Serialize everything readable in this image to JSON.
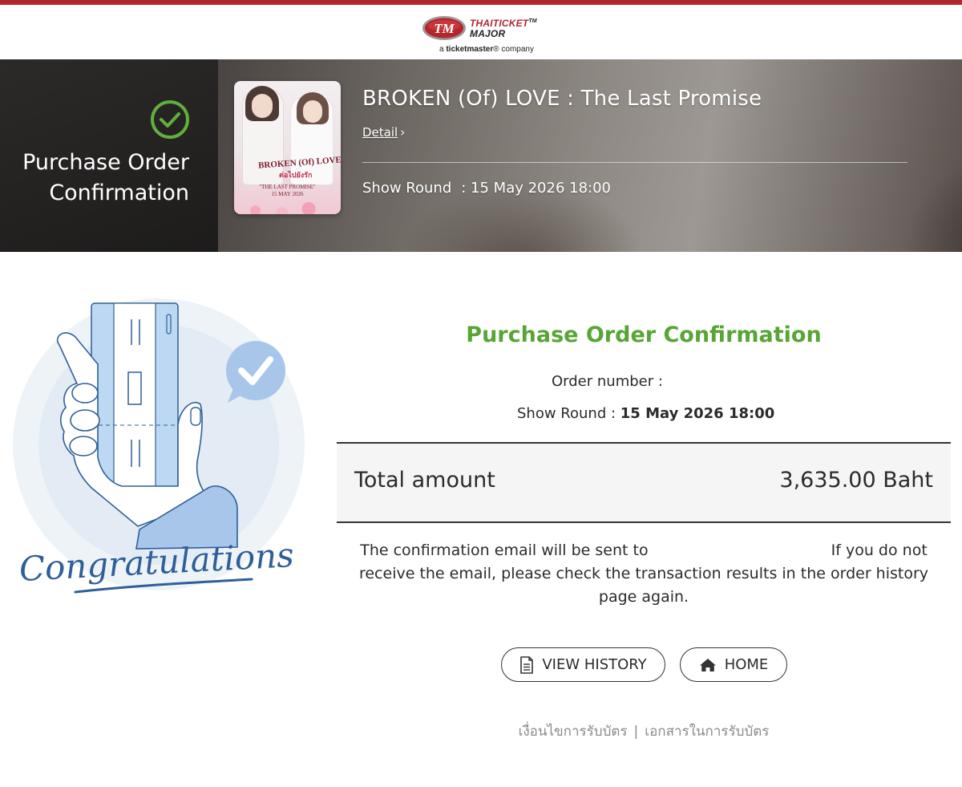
{
  "brand": {
    "name_line1": "THAITICKET",
    "name_line2": "MAJOR",
    "tm": "TM",
    "tagline_prefix": "a",
    "tagline_brand": "ticketmaster",
    "tagline_suffix": "® company",
    "accent_color": "#b3262b"
  },
  "banner": {
    "status_icon": "check-circle-icon",
    "status_title_line1": "Purchase Order",
    "status_title_line2": "Confirmation",
    "event_title": "BROKEN (Of) LOVE : The Last Promise",
    "detail_label": "Detail",
    "show_round_label": "Show Round",
    "show_round_value": ": 15 May 2026 18:00",
    "poster": {
      "title": "BROKEN (Of) LOVE",
      "subtitle_thai": "ต่อไปยังรัก",
      "tagline": "\"THE LAST PROMISE\"",
      "date": "15 MAY 2026"
    }
  },
  "illustration": {
    "caption": "Congratulations",
    "accent_color": "#2f5f98"
  },
  "confirmation": {
    "title": "Purchase Order Confirmation",
    "title_color": "#57a635",
    "order_number_label": "Order number :",
    "show_round_label": "Show Round :",
    "show_round_value": "15 May 2026 18:00",
    "total_label": "Total amount",
    "total_value": "3,635.00 Baht",
    "note_part1": "The confirmation email will be sent to",
    "note_part2": "If you do not receive the email, please check the transaction results in the order history page again."
  },
  "buttons": {
    "view_history": "VIEW HISTORY",
    "home": "HOME"
  },
  "footer": {
    "link1": "เงื่อนไขการรับบัตร",
    "separator": "|",
    "link2": "เอกสารในการรับบัตร"
  }
}
